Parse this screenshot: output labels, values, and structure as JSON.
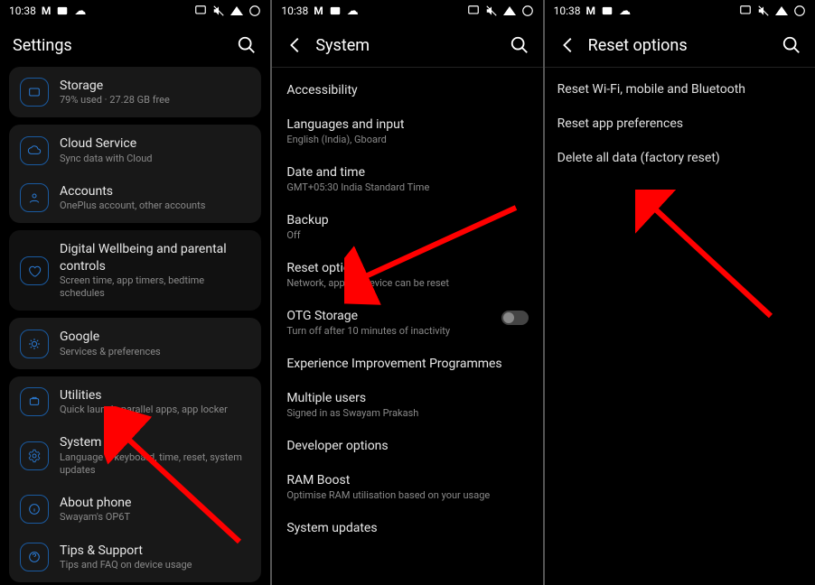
{
  "status": {
    "time": "10:38",
    "m_glyph": "M"
  },
  "screen1": {
    "title": "Settings",
    "storage": {
      "label": "Storage",
      "sub": "79% used · 27.28 GB free"
    },
    "cloud": {
      "label": "Cloud Service",
      "sub": "Sync data with Cloud"
    },
    "accounts": {
      "label": "Accounts",
      "sub": "OnePlus account, other accounts"
    },
    "wellbeing": {
      "label": "Digital Wellbeing and parental controls",
      "sub": "Screen time, app timers, bedtime schedules"
    },
    "google": {
      "label": "Google",
      "sub": "Services & preferences"
    },
    "utilities": {
      "label": "Utilities",
      "sub": "Quick launch, parallel apps, app locker"
    },
    "system": {
      "label": "System",
      "sub": "Language & keyboard, time, reset, system updates"
    },
    "about": {
      "label": "About phone",
      "sub": "Swayam's OP6T"
    },
    "tips": {
      "label": "Tips & Support",
      "sub": "Tips and FAQ on device usage"
    }
  },
  "screen2": {
    "title": "System",
    "accessibility": {
      "label": "Accessibility"
    },
    "languages": {
      "label": "Languages and input",
      "sub": "English (India), Gboard"
    },
    "datetime": {
      "label": "Date and time",
      "sub": "GMT+05:30 India Standard Time"
    },
    "backup": {
      "label": "Backup",
      "sub": "Off"
    },
    "reset": {
      "label": "Reset options",
      "sub": "Network, apps or device can be reset"
    },
    "otg": {
      "label": "OTG Storage",
      "sub": "Turn off after 10 minutes of inactivity"
    },
    "eip": {
      "label": "Experience Improvement Programmes"
    },
    "users": {
      "label": "Multiple users",
      "sub": "Signed in as Swayam Prakash"
    },
    "devopts": {
      "label": "Developer options"
    },
    "ramboost": {
      "label": "RAM Boost",
      "sub": "Optimise RAM utilisation based on your usage"
    },
    "sysupdates": {
      "label": "System updates"
    }
  },
  "screen3": {
    "title": "Reset options",
    "wifi": {
      "label": "Reset Wi-Fi, mobile and Bluetooth"
    },
    "apps": {
      "label": "Reset app preferences"
    },
    "factory": {
      "label": "Delete all data (factory reset)"
    }
  }
}
